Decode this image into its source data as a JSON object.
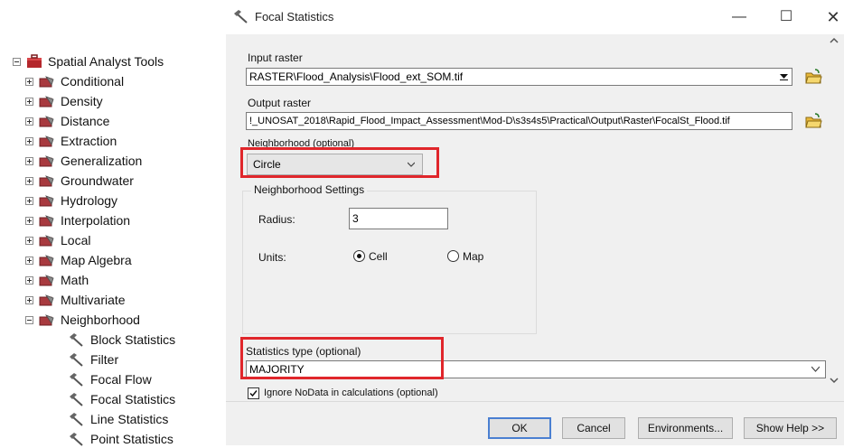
{
  "toolbox": {
    "root_label": "Spatial Analyst Tools",
    "categories": [
      {
        "label": "Conditional"
      },
      {
        "label": "Density"
      },
      {
        "label": "Distance"
      },
      {
        "label": "Extraction"
      },
      {
        "label": "Generalization"
      },
      {
        "label": "Groundwater"
      },
      {
        "label": "Hydrology"
      },
      {
        "label": "Interpolation"
      },
      {
        "label": "Local"
      },
      {
        "label": "Map Algebra"
      },
      {
        "label": "Math"
      },
      {
        "label": "Multivariate"
      },
      {
        "label": "Neighborhood"
      }
    ],
    "neighborhood_tools": [
      {
        "label": "Block Statistics"
      },
      {
        "label": "Filter"
      },
      {
        "label": "Focal Flow"
      },
      {
        "label": "Focal Statistics"
      },
      {
        "label": "Line Statistics"
      },
      {
        "label": "Point Statistics"
      }
    ]
  },
  "dialog": {
    "title": "Focal Statistics",
    "window_buttons": {
      "minimize": "—",
      "maximize": "☐",
      "close": "✕"
    },
    "input_raster": {
      "label": "Input raster",
      "value": "RASTER\\Flood_Analysis\\Flood_ext_SOM.tif"
    },
    "output_raster": {
      "label": "Output raster",
      "value": "!_UNOSAT_2018\\Rapid_Flood_Impact_Assessment\\Mod-D\\s3s4s5\\Practical\\Output\\Raster\\FocalSt_Flood.tif"
    },
    "neighborhood": {
      "label": "Neighborhood (optional)",
      "selected": "Circle"
    },
    "neighborhood_settings": {
      "title": "Neighborhood Settings",
      "radius_label": "Radius:",
      "radius_value": "3",
      "units_label": "Units:",
      "unit_cell": "Cell",
      "unit_map": "Map",
      "selected_unit": "Cell"
    },
    "statistics_type": {
      "label": "Statistics type (optional)",
      "value": "MAJORITY"
    },
    "ignore_nodata": {
      "label": "Ignore NoData in calculations (optional)",
      "checked": true
    },
    "buttons": {
      "ok": "OK",
      "cancel": "Cancel",
      "environments": "Environments...",
      "show_help": "Show Help >>"
    }
  },
  "colors": {
    "highlight": "#e0262b",
    "dialog_bg": "#f0f0f0",
    "default_button_border": "#4a7fd1"
  },
  "icons": {
    "toolbox": "toolbox-icon",
    "toolset": "toolset-icon",
    "tool": "hammer-tool-icon",
    "folder": "open-folder-icon"
  }
}
